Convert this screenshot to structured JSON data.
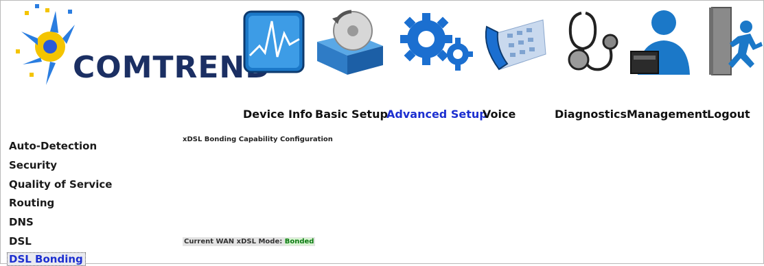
{
  "brand": {
    "name": "COMTREND"
  },
  "nav": [
    {
      "label": "Device Info",
      "icon": "device-info-icon",
      "active": false
    },
    {
      "label": "Basic Setup",
      "icon": "basic-setup-icon",
      "active": false
    },
    {
      "label": "Advanced Setup",
      "icon": "advanced-setup-icon",
      "active": true
    },
    {
      "label": "Voice",
      "icon": "voice-icon",
      "active": false
    },
    {
      "label": "Diagnostics",
      "icon": "diagnostics-icon",
      "active": false
    },
    {
      "label": "Management",
      "icon": "management-icon",
      "active": false
    },
    {
      "label": "Logout",
      "icon": "logout-icon",
      "active": false
    }
  ],
  "sidebar": {
    "items": [
      {
        "label": "Auto-Detection"
      },
      {
        "label": "Security"
      },
      {
        "label": "Quality of Service"
      },
      {
        "label": "Routing"
      },
      {
        "label": "DNS"
      },
      {
        "label": "DSL"
      },
      {
        "label": "DSL Bonding",
        "active": true
      }
    ]
  },
  "main": {
    "title": "xDSL Bonding Capability Configuration",
    "mode_label": "Current WAN xDSL Mode:",
    "mode_value": "Bonded"
  },
  "colors": {
    "active_text": "#1c2fd0",
    "brand": "#1b2f63",
    "bonded": "#0c7a12"
  }
}
